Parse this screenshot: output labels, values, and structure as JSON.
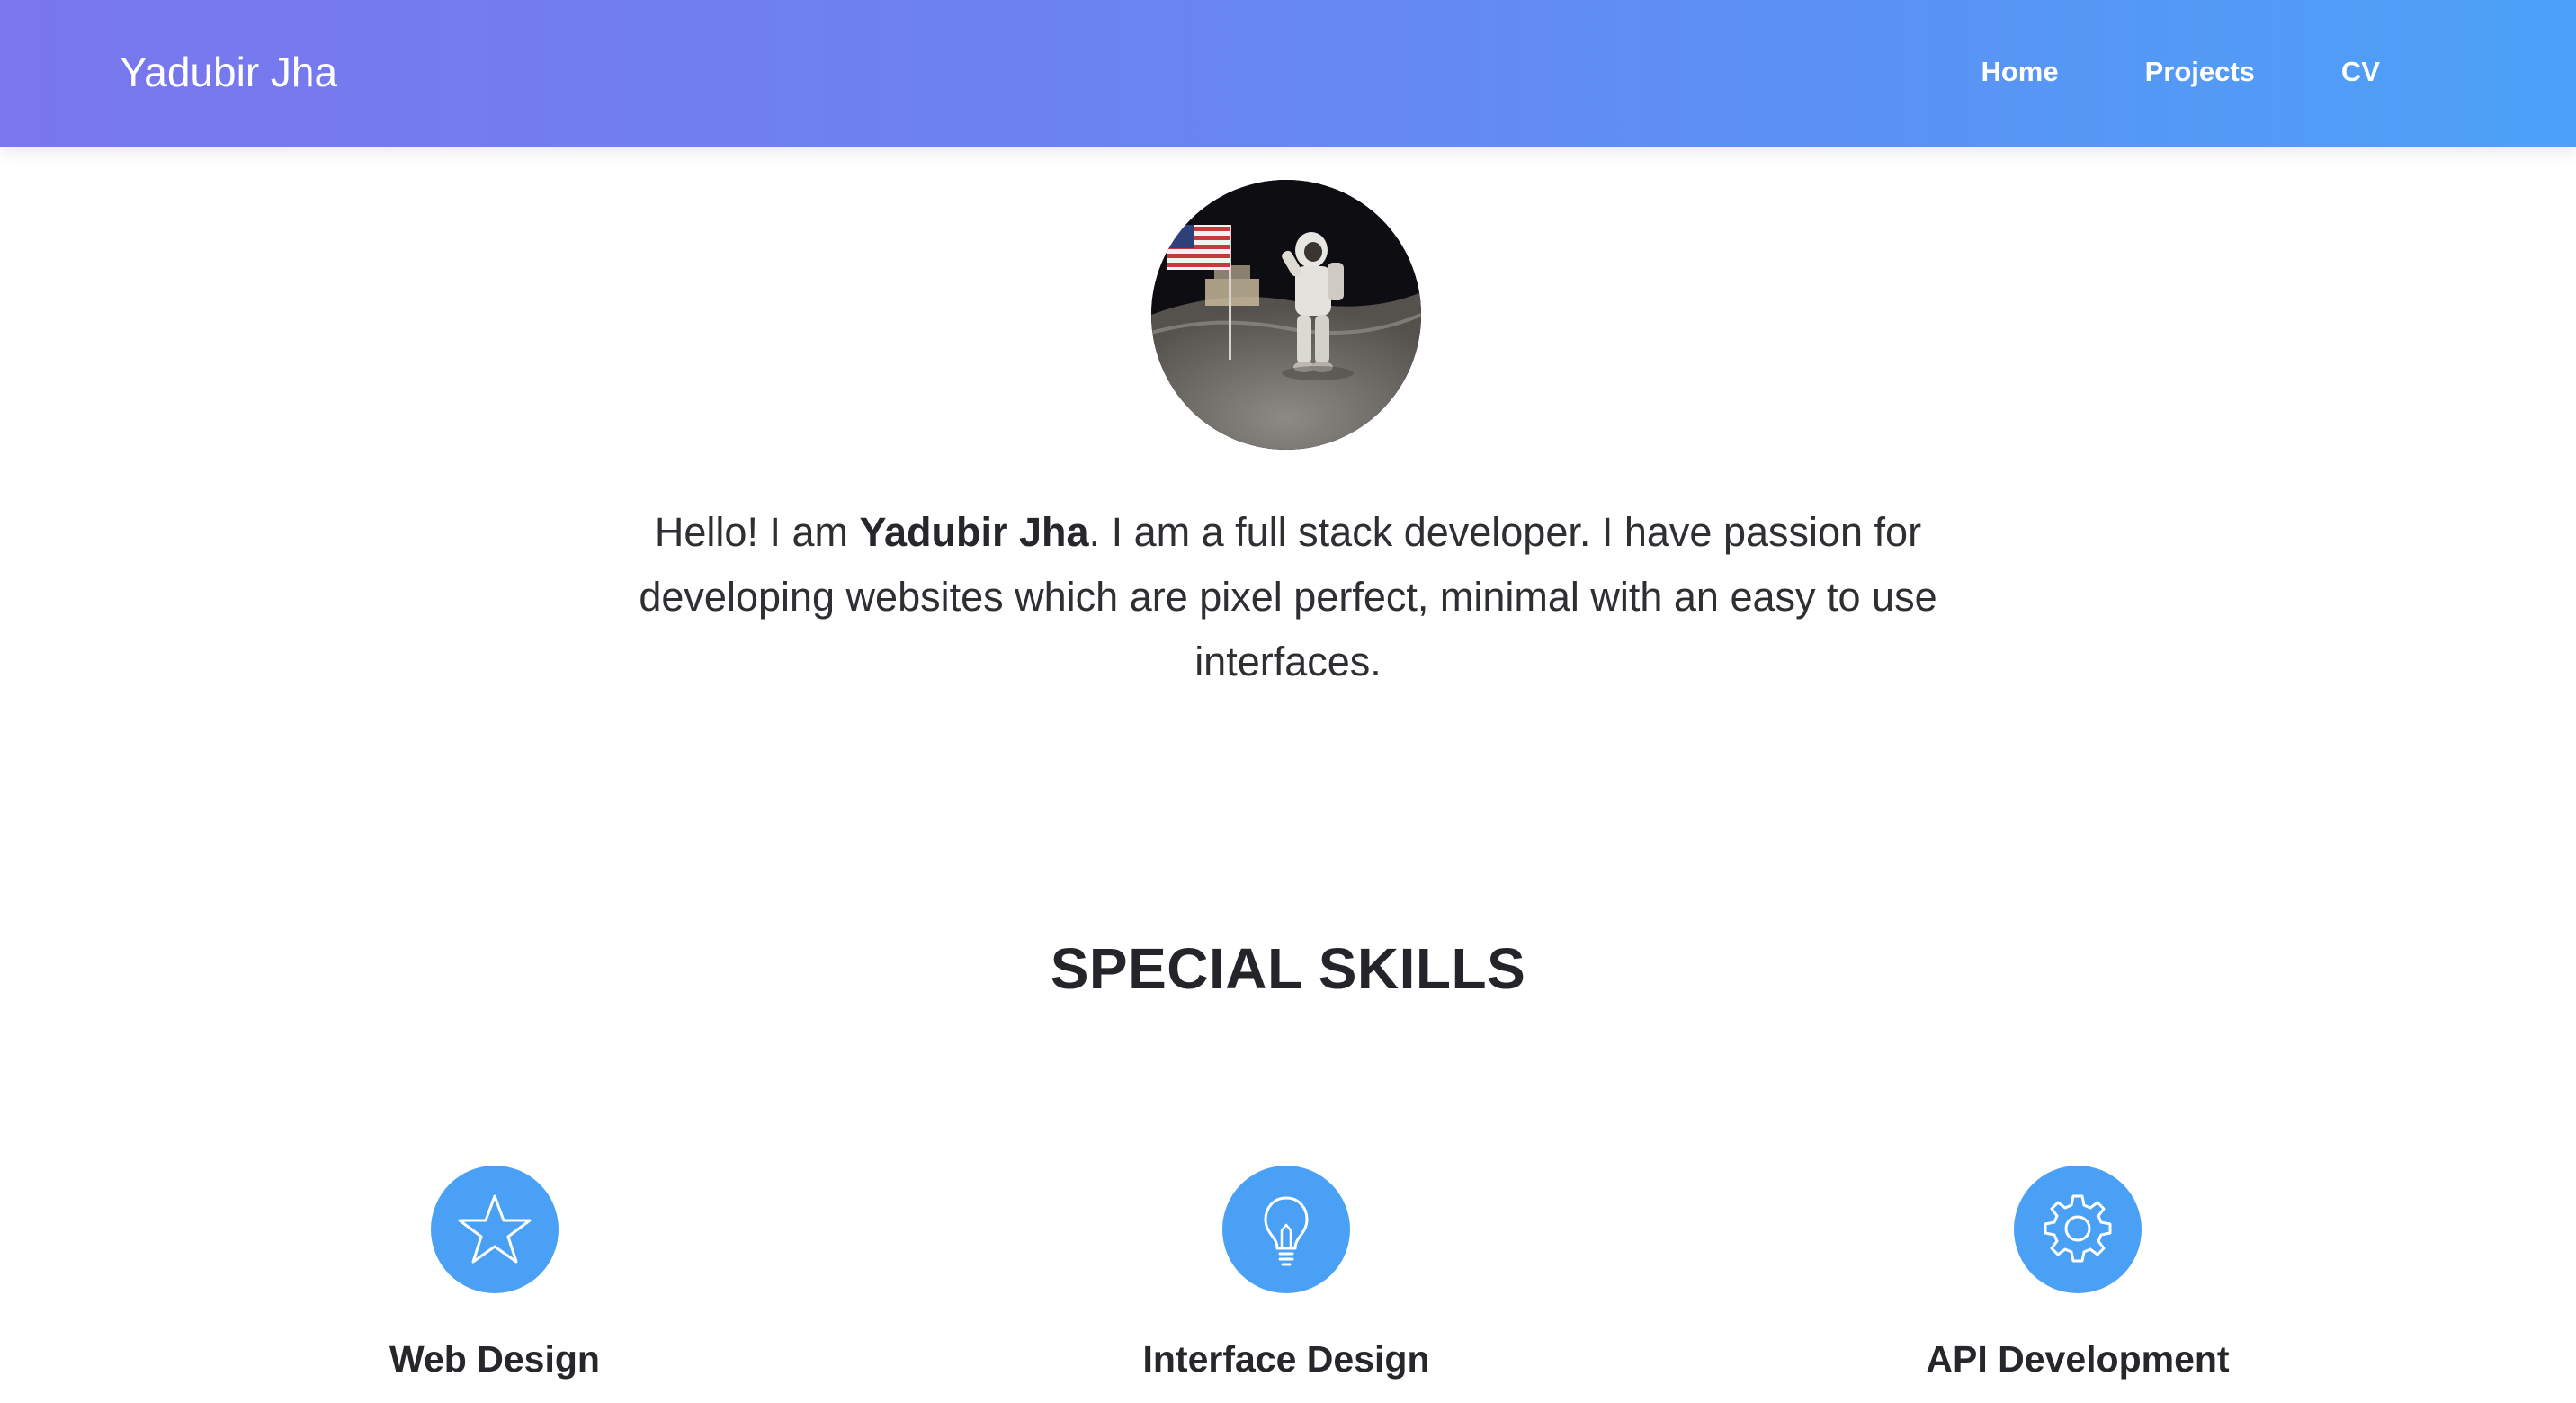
{
  "navbar": {
    "brand": "Yadubir Jha",
    "links": [
      "Home",
      "Projects",
      "CV"
    ]
  },
  "profile": {
    "avatar_icon": "astronaut-photo",
    "intro_prefix": "Hello! I am ",
    "intro_name": "Yadubir Jha",
    "intro_suffix": ". I am a full stack developer. I have passion for developing websites which are pixel perfect, minimal with an easy to use interfaces."
  },
  "skills": {
    "title": "SPECIAL SKILLS",
    "items": [
      {
        "label": "Web Design",
        "icon": "star-icon"
      },
      {
        "label": "Interface Design",
        "icon": "lightbulb-icon"
      },
      {
        "label": "API Development",
        "icon": "gear-icon"
      }
    ]
  },
  "colors": {
    "gradient_start": "#7a76ed",
    "gradient_end": "#4ba1f7",
    "icon_circle": "#4aa0f5"
  }
}
